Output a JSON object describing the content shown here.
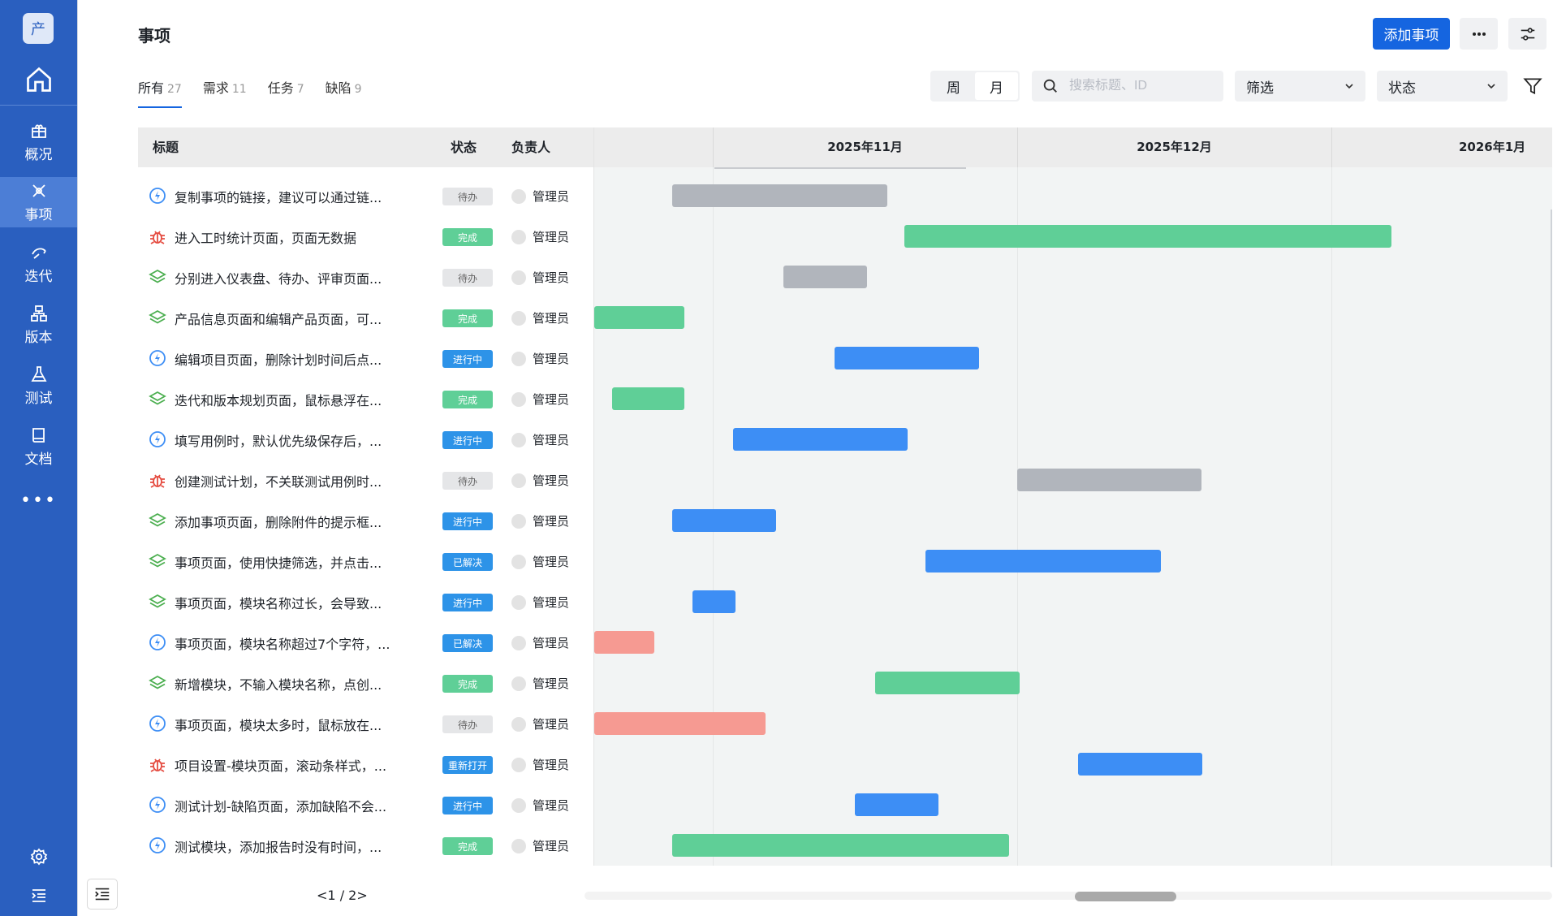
{
  "app": {
    "logo_text": "产"
  },
  "sidebar": {
    "items": [
      {
        "label": "概况",
        "icon": "overview-icon"
      },
      {
        "label": "事项",
        "icon": "issues-icon"
      },
      {
        "label": "迭代",
        "icon": "iteration-icon"
      },
      {
        "label": "版本",
        "icon": "version-icon"
      },
      {
        "label": "测试",
        "icon": "flask-icon"
      },
      {
        "label": "文档",
        "icon": "book-icon"
      }
    ],
    "more": "•••"
  },
  "header": {
    "title": "事项",
    "add_button": "添加事项"
  },
  "tabs": [
    {
      "label": "所有",
      "count": "27"
    },
    {
      "label": "需求",
      "count": "11"
    },
    {
      "label": "任务",
      "count": "7"
    },
    {
      "label": "缺陷",
      "count": "9"
    }
  ],
  "view": {
    "week": "周",
    "month": "月",
    "selected": "月"
  },
  "search": {
    "placeholder": "搜索标题、ID"
  },
  "filters": {
    "filter_label": "筛选",
    "status_label": "状态"
  },
  "table": {
    "col_title": "标题",
    "col_status": "状态",
    "col_owner": "负责人"
  },
  "months": [
    "2025年11月",
    "2025年12月",
    "2026年1月"
  ],
  "colors": {
    "sidebar": "#2a5fbf",
    "primary": "#1565e0",
    "todo": "#b1b5bc",
    "done": "#5fcf97",
    "progress": "#3d8ef5",
    "bug": "#f69a92"
  },
  "status_styles": {
    "待办": {
      "bg": "#e5e6e8",
      "fg": "#666666"
    },
    "完成": {
      "bg": "#5fcf97",
      "fg": "#ffffff"
    },
    "进行中": {
      "bg": "#2d93e8",
      "fg": "#ffffff"
    },
    "已解决": {
      "bg": "#2d93e8",
      "fg": "#ffffff"
    },
    "重新打开": {
      "bg": "#2d93e8",
      "fg": "#ffffff"
    }
  },
  "rows": [
    {
      "type": "task",
      "title": "复制事项的链接，建议可以通过链...",
      "status": "待办",
      "owner": "管理员",
      "bar_color": "todo"
    },
    {
      "type": "bug",
      "title": "进入工时统计页面，页面无数据",
      "status": "完成",
      "owner": "管理员",
      "bar_color": "done"
    },
    {
      "type": "story",
      "title": "分别进入仪表盘、待办、评审页面...",
      "status": "待办",
      "owner": "管理员",
      "bar_color": "todo"
    },
    {
      "type": "story",
      "title": "产品信息页面和编辑产品页面，可...",
      "status": "完成",
      "owner": "管理员",
      "bar_color": "done"
    },
    {
      "type": "task",
      "title": "编辑项目页面，删除计划时间后点...",
      "status": "进行中",
      "owner": "管理员",
      "bar_color": "progress"
    },
    {
      "type": "story",
      "title": "迭代和版本规划页面，鼠标悬浮在...",
      "status": "完成",
      "owner": "管理员",
      "bar_color": "done"
    },
    {
      "type": "task",
      "title": "填写用例时，默认优先级保存后，...",
      "status": "进行中",
      "owner": "管理员",
      "bar_color": "progress"
    },
    {
      "type": "bug",
      "title": "创建测试计划，不关联测试用例时...",
      "status": "待办",
      "owner": "管理员",
      "bar_color": "todo"
    },
    {
      "type": "story",
      "title": "添加事项页面，删除附件的提示框...",
      "status": "进行中",
      "owner": "管理员",
      "bar_color": "progress"
    },
    {
      "type": "story",
      "title": "事项页面，使用快捷筛选，并点击...",
      "status": "已解决",
      "owner": "管理员",
      "bar_color": "progress"
    },
    {
      "type": "story",
      "title": "事项页面，模块名称过长，会导致...",
      "status": "进行中",
      "owner": "管理员",
      "bar_color": "progress"
    },
    {
      "type": "task",
      "title": "事项页面，模块名称超过7个字符，...",
      "status": "已解决",
      "owner": "管理员",
      "bar_color": "bug"
    },
    {
      "type": "story",
      "title": "新增模块，不输入模块名称，点创...",
      "status": "完成",
      "owner": "管理员",
      "bar_color": "done"
    },
    {
      "type": "task",
      "title": "事项页面，模块太多时，鼠标放在...",
      "status": "待办",
      "owner": "管理员",
      "bar_color": "bug"
    },
    {
      "type": "bug",
      "title": "项目设置-模块页面，滚动条样式，...",
      "status": "重新打开",
      "owner": "管理员",
      "bar_color": "progress"
    },
    {
      "type": "task",
      "title": "测试计划-缺陷页面，添加缺陷不会...",
      "status": "进行中",
      "owner": "管理员",
      "bar_color": "progress"
    },
    {
      "type": "task",
      "title": "测试模块，添加报告时没有时间，...",
      "status": "完成",
      "owner": "管理员",
      "bar_color": "done"
    }
  ],
  "pager": {
    "prev": "<",
    "current": "1",
    "sep": "/",
    "total": "2",
    "next": ">"
  }
}
